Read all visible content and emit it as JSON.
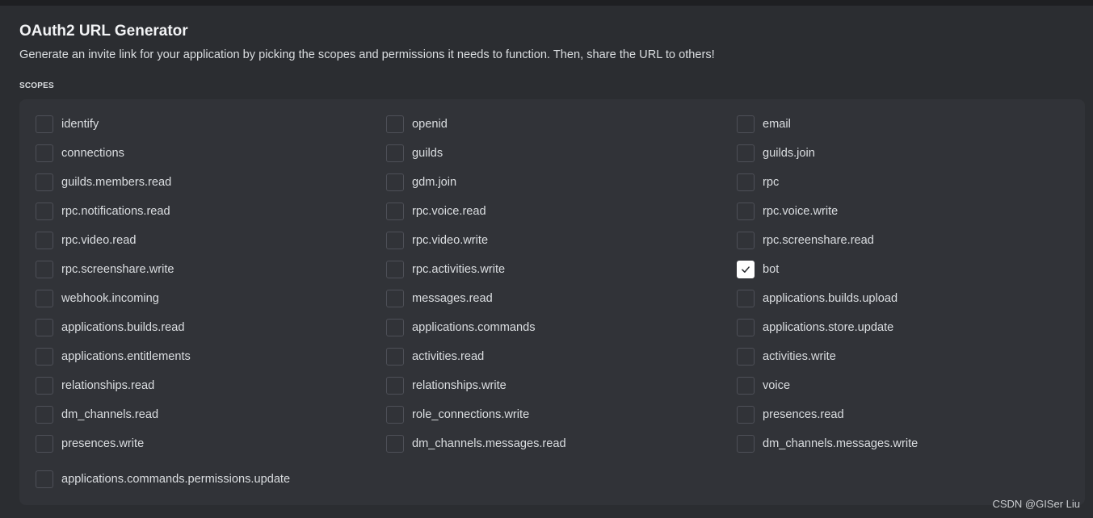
{
  "header": {
    "title": "OAuth2 URL Generator",
    "description": "Generate an invite link for your application by picking the scopes and permissions it needs to function. Then, share the URL to others!"
  },
  "scopes": {
    "label": "SCOPES",
    "items": [
      {
        "label": "identify",
        "checked": false
      },
      {
        "label": "openid",
        "checked": false
      },
      {
        "label": "email",
        "checked": false
      },
      {
        "label": "connections",
        "checked": false
      },
      {
        "label": "guilds",
        "checked": false
      },
      {
        "label": "guilds.join",
        "checked": false
      },
      {
        "label": "guilds.members.read",
        "checked": false
      },
      {
        "label": "gdm.join",
        "checked": false
      },
      {
        "label": "rpc",
        "checked": false
      },
      {
        "label": "rpc.notifications.read",
        "checked": false
      },
      {
        "label": "rpc.voice.read",
        "checked": false
      },
      {
        "label": "rpc.voice.write",
        "checked": false
      },
      {
        "label": "rpc.video.read",
        "checked": false
      },
      {
        "label": "rpc.video.write",
        "checked": false
      },
      {
        "label": "rpc.screenshare.read",
        "checked": false
      },
      {
        "label": "rpc.screenshare.write",
        "checked": false
      },
      {
        "label": "rpc.activities.write",
        "checked": false
      },
      {
        "label": "bot",
        "checked": true
      },
      {
        "label": "webhook.incoming",
        "checked": false
      },
      {
        "label": "messages.read",
        "checked": false
      },
      {
        "label": "applications.builds.upload",
        "checked": false
      },
      {
        "label": "applications.builds.read",
        "checked": false
      },
      {
        "label": "applications.commands",
        "checked": false
      },
      {
        "label": "applications.store.update",
        "checked": false
      },
      {
        "label": "applications.entitlements",
        "checked": false
      },
      {
        "label": "activities.read",
        "checked": false
      },
      {
        "label": "activities.write",
        "checked": false
      },
      {
        "label": "relationships.read",
        "checked": false
      },
      {
        "label": "relationships.write",
        "checked": false
      },
      {
        "label": "voice",
        "checked": false
      },
      {
        "label": "dm_channels.read",
        "checked": false
      },
      {
        "label": "role_connections.write",
        "checked": false
      },
      {
        "label": "presences.read",
        "checked": false
      },
      {
        "label": "presences.write",
        "checked": false
      },
      {
        "label": "dm_channels.messages.read",
        "checked": false
      },
      {
        "label": "dm_channels.messages.write",
        "checked": false
      },
      {
        "label": "applications.commands.permissions.update",
        "checked": false
      }
    ]
  },
  "watermark": "CSDN @GISer Liu",
  "icons": {
    "checkmark": "check-icon"
  },
  "colors": {
    "page_bg": "#2b2d31",
    "panel_bg": "#313338",
    "checkbox_border": "#4e5058",
    "checked_fill": "#ffffff",
    "text": "#dbdee1",
    "title": "#f2f3f5"
  }
}
